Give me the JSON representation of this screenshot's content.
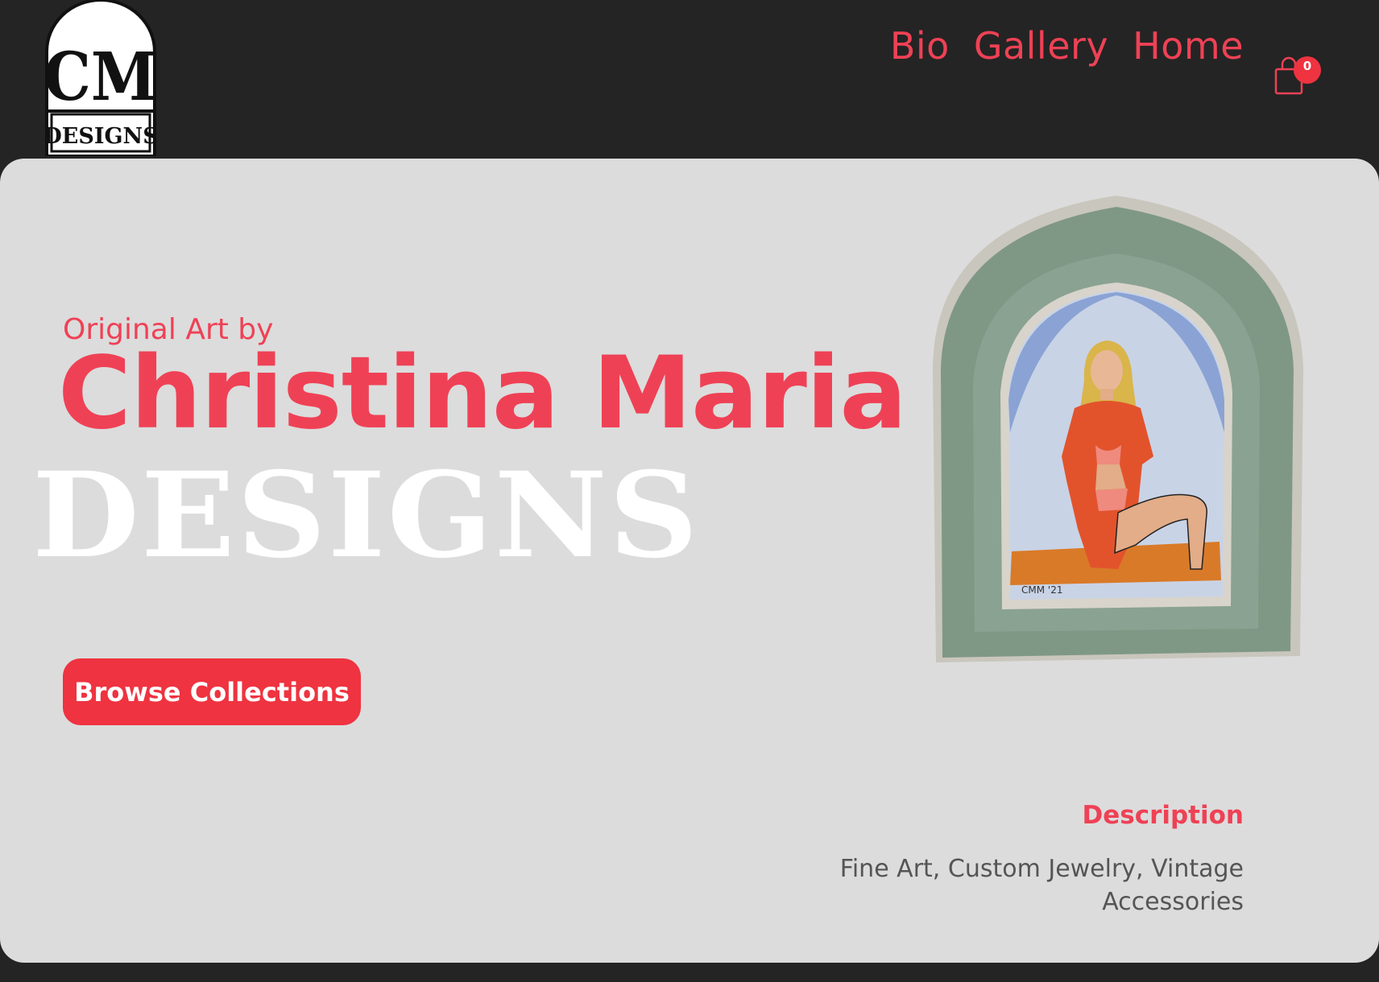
{
  "header": {
    "logo": {
      "monogram": "CM",
      "subtitle": "DESIGNS"
    },
    "nav": {
      "items": [
        {
          "label": "Bio"
        },
        {
          "label": "Gallery"
        },
        {
          "label": "Home"
        }
      ]
    },
    "cart": {
      "count": "0",
      "icon": "shopping-bag-icon"
    }
  },
  "hero": {
    "eyebrow": "Original Art by",
    "name": "Christina Maria",
    "designs": "DESIGNS",
    "browse_label": "Browse Collections",
    "description_title": "Description",
    "description_text": "Fine Art, Custom Jewelry, Vintage Accessories"
  },
  "colors": {
    "accent": "#ef4155",
    "button": "#ef3340",
    "header_bg": "#242424",
    "hero_bg": "#dcdcdc"
  }
}
